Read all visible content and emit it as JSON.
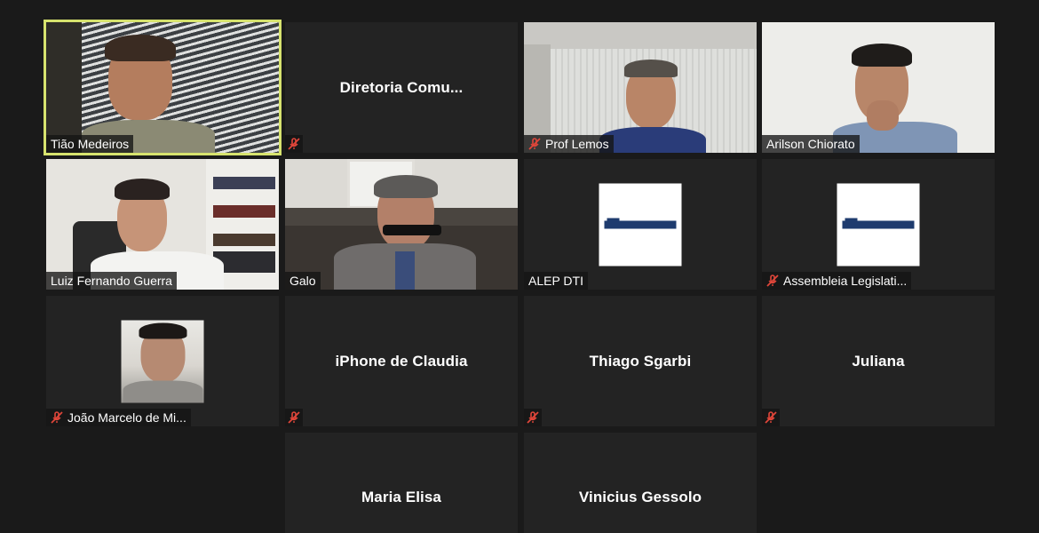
{
  "participants": [
    {
      "name": "Tião Medeiros",
      "video": true,
      "muted": false,
      "active": true,
      "display": "label"
    },
    {
      "name": "Diretoria  Comu...",
      "video": false,
      "muted": true,
      "display": "center"
    },
    {
      "name": "Prof Lemos",
      "video": true,
      "muted": true,
      "display": "label"
    },
    {
      "name": "Arilson Chiorato",
      "video": true,
      "muted": false,
      "display": "label"
    },
    {
      "name": "Luiz Fernando Guerra",
      "video": true,
      "muted": false,
      "display": "label"
    },
    {
      "name": "Galo",
      "video": true,
      "muted": false,
      "display": "label"
    },
    {
      "name": "ALEP DTI",
      "video": false,
      "muted": false,
      "display": "label",
      "picture": "logo"
    },
    {
      "name": "Assembleia Legislati...",
      "video": false,
      "muted": true,
      "display": "label",
      "picture": "logo"
    },
    {
      "name": "João Marcelo de Mi...",
      "video": false,
      "muted": true,
      "display": "label",
      "picture": "avatar"
    },
    {
      "name": "iPhone de Claudia",
      "video": false,
      "muted": true,
      "display": "center"
    },
    {
      "name": "Thiago Sgarbi",
      "video": false,
      "muted": true,
      "display": "center"
    },
    {
      "name": "Juliana",
      "video": false,
      "muted": true,
      "display": "center"
    },
    {
      "name": "Maria Elisa",
      "video": false,
      "muted": false,
      "display": "center"
    },
    {
      "name": "Vinicius Gessolo",
      "video": false,
      "muted": false,
      "display": "center"
    }
  ],
  "colors": {
    "background": "#1a1a1a",
    "tile": "#232323",
    "active_speaker_border": "#d7e36e",
    "muted_icon": "#e0463a"
  },
  "icons": {
    "muted": "mic-muted-icon"
  }
}
